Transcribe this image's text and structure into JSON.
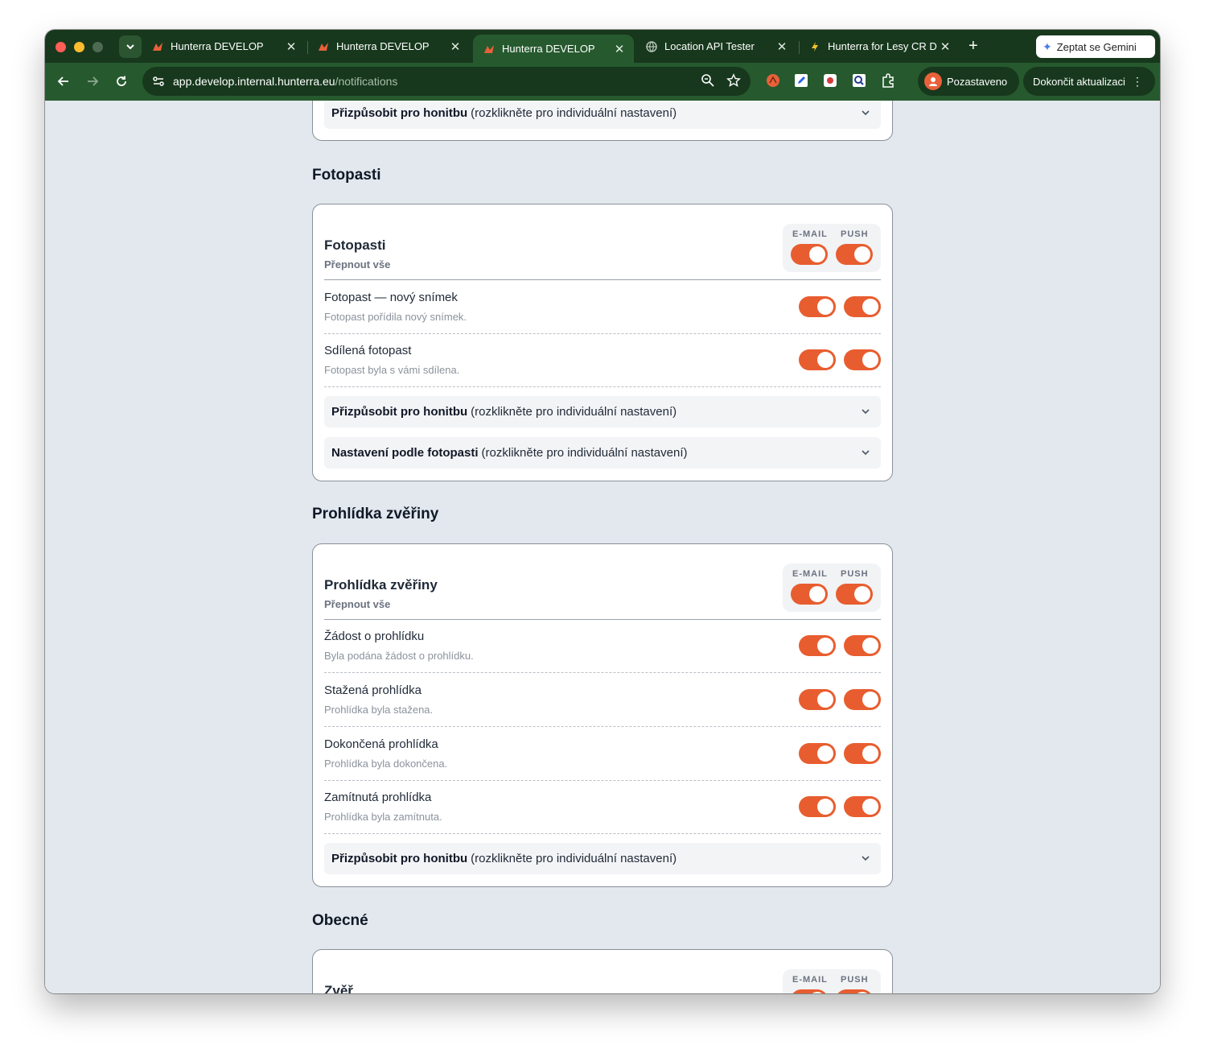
{
  "browser": {
    "tabs": [
      {
        "title": "Hunterra DEVELOP",
        "active": false
      },
      {
        "title": "Hunterra DEVELOP",
        "active": false
      },
      {
        "title": "Hunterra DEVELOP",
        "active": true
      },
      {
        "title": "Location API Tester",
        "active": false
      },
      {
        "title": "Hunterra for Lesy CR D",
        "active": false
      }
    ],
    "gemini_label": "Zeptat se Gemini",
    "url_host": "app.develop.internal.hunterra.eu",
    "url_path": "/notifications",
    "profile_label": "Pozastaveno",
    "update_label": "Dokončit aktualizaci"
  },
  "page": {
    "top_expander": {
      "bold": "Přizpůsobit pro honitbu",
      "rest": "(rozklikněte pro individuální nastavení)"
    },
    "sections": [
      {
        "heading": "Fotopasti",
        "group_title": "Fotopasti",
        "group_sub": "Přepnout vše",
        "col_email": "E-MAIL",
        "col_push": "PUSH",
        "rows": [
          {
            "title": "Fotopast — nový snímek",
            "desc": "Fotopast pořídila nový snímek.",
            "email": true,
            "push": true
          },
          {
            "title": "Sdílená fotopast",
            "desc": "Fotopast byla s vámi sdílena.",
            "email": true,
            "push": true
          }
        ],
        "expanders": [
          {
            "bold": "Přizpůsobit pro honitbu",
            "rest": "(rozklikněte pro individuální nastavení)"
          },
          {
            "bold": "Nastavení podle fotopasti",
            "rest": "(rozklikněte pro individuální nastavení)"
          }
        ]
      },
      {
        "heading": "Prohlídka zvěřiny",
        "group_title": "Prohlídka zvěřiny",
        "group_sub": "Přepnout vše",
        "col_email": "E-MAIL",
        "col_push": "PUSH",
        "rows": [
          {
            "title": "Žádost o prohlídku",
            "desc": "Byla podána žádost o prohlídku.",
            "email": true,
            "push": true
          },
          {
            "title": "Stažená prohlídka",
            "desc": "Prohlídka byla stažena.",
            "email": true,
            "push": true
          },
          {
            "title": "Dokončená prohlídka",
            "desc": "Prohlídka byla dokončena.",
            "email": true,
            "push": true
          },
          {
            "title": "Zamítnutá prohlídka",
            "desc": "Prohlídka byla zamítnuta.",
            "email": true,
            "push": true
          }
        ],
        "expanders": [
          {
            "bold": "Přizpůsobit pro honitbu",
            "rest": "(rozklikněte pro individuální nastavení)"
          }
        ]
      },
      {
        "heading": "Obecné",
        "group_title": "Zvěř",
        "col_email": "E-MAIL",
        "col_push": "PUSH"
      }
    ]
  },
  "colors": {
    "accent": "#e85d2f",
    "chrome_dark": "#17381d",
    "chrome": "#265a2e",
    "page_bg": "#e2e8ee"
  }
}
